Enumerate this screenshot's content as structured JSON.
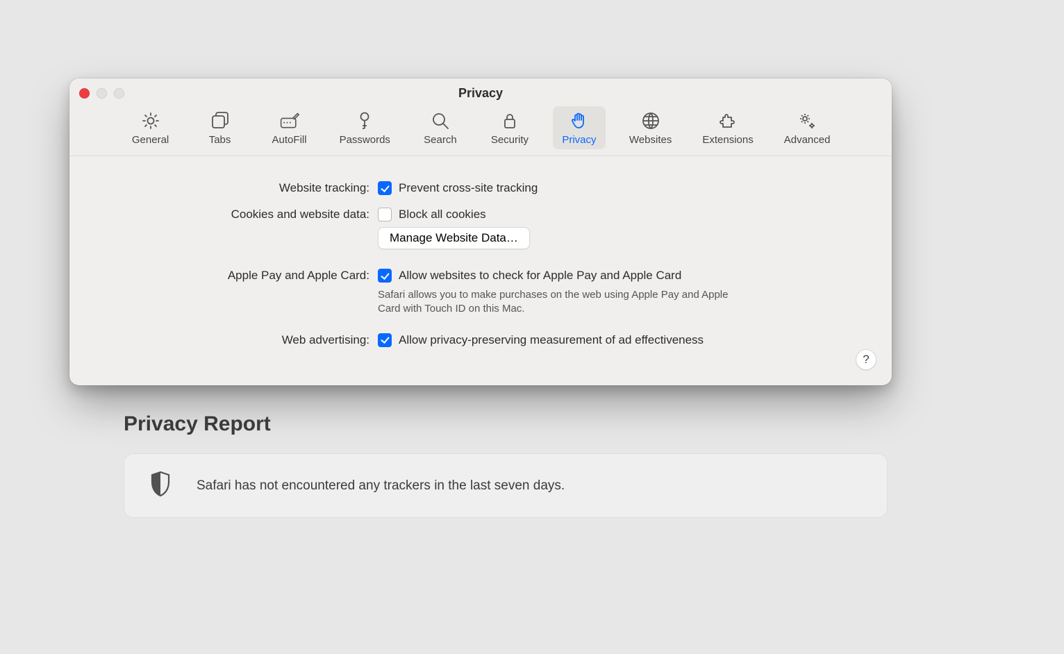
{
  "window": {
    "title": "Privacy"
  },
  "toolbar": {
    "items": [
      {
        "label": "General",
        "icon": "gear"
      },
      {
        "label": "Tabs",
        "icon": "tabs"
      },
      {
        "label": "AutoFill",
        "icon": "autofill"
      },
      {
        "label": "Passwords",
        "icon": "key"
      },
      {
        "label": "Search",
        "icon": "search"
      },
      {
        "label": "Security",
        "icon": "lock"
      },
      {
        "label": "Privacy",
        "icon": "hand"
      },
      {
        "label": "Websites",
        "icon": "globe"
      },
      {
        "label": "Extensions",
        "icon": "puzzle"
      },
      {
        "label": "Advanced",
        "icon": "gears"
      }
    ],
    "selected": "Privacy"
  },
  "form": {
    "website_tracking": {
      "label": "Website tracking:",
      "option": "Prevent cross-site tracking",
      "checked": true
    },
    "cookies": {
      "label": "Cookies and website data:",
      "option": "Block all cookies",
      "checked": false,
      "manage_button": "Manage Website Data…"
    },
    "apple_pay": {
      "label": "Apple Pay and Apple Card:",
      "option": "Allow websites to check for Apple Pay and Apple Card",
      "checked": true,
      "subtext": "Safari allows you to make purchases on the web using Apple Pay and Apple Card with Touch ID on this Mac."
    },
    "web_advertising": {
      "label": "Web advertising:",
      "option": "Allow privacy-preserving measurement of ad effectiveness",
      "checked": true
    },
    "help": "?"
  },
  "report": {
    "heading": "Privacy Report",
    "message": "Safari has not encountered any trackers in the last seven days."
  }
}
